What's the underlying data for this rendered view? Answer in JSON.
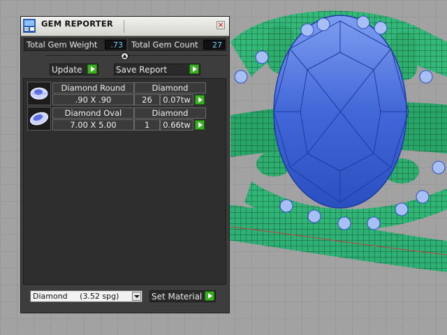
{
  "window": {
    "title": "GEM REPORTER",
    "close_label": "×"
  },
  "stats": {
    "total_weight_label": "Total Gem Weight",
    "total_weight_value": ".73",
    "total_count_label": "Total Gem Count",
    "total_count_value": "27"
  },
  "toolbar": {
    "update_label": "Update",
    "save_label": "Save Report"
  },
  "gems": [
    {
      "name": "Diamond Round",
      "material": "Diamond",
      "size": ".90 X .90",
      "count": "26",
      "weight": "0.07tw",
      "icon": "round-gem-icon"
    },
    {
      "name": "Diamond Oval",
      "material": "Diamond",
      "size": "7.00 X 5.00",
      "count": "1",
      "weight": "0.66tw",
      "icon": "oval-gem-icon"
    }
  ],
  "footer": {
    "material_select": "Diamond     (3.52 spg)",
    "set_material_label": "Set Material"
  },
  "colors": {
    "viewport_bg": "#a2a2a2",
    "ring_green": "#2fb074",
    "gem_blue": "#3a5fd0",
    "accent_green": "#3cae22",
    "value_text": "#6fd0ff"
  }
}
